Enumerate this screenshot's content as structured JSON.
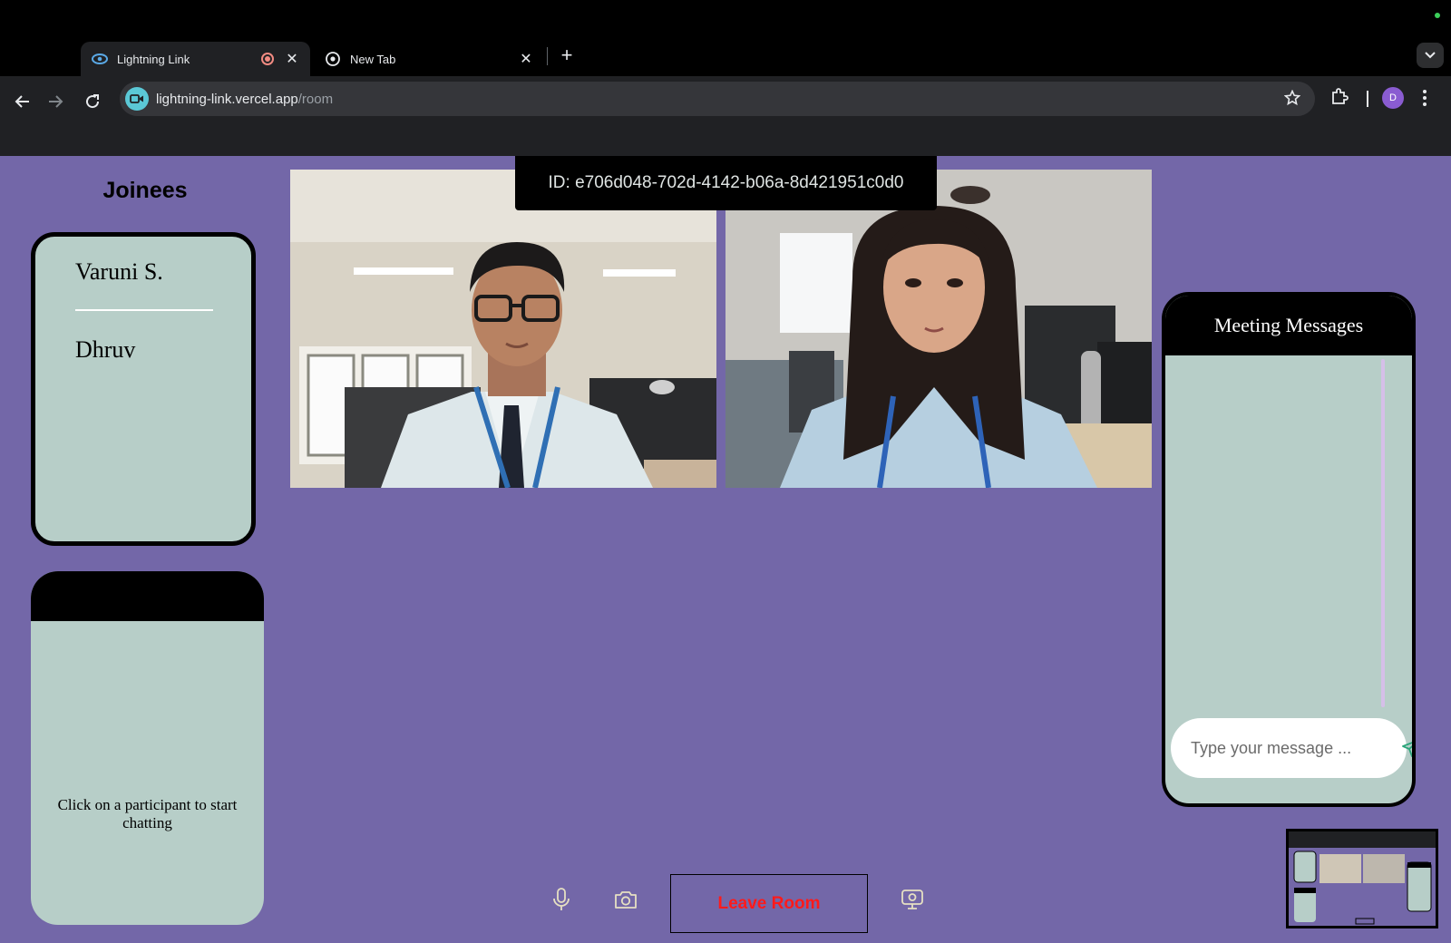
{
  "browser": {
    "tabs": [
      {
        "title": "Lightning Link",
        "active": true
      },
      {
        "title": "New Tab",
        "active": false
      }
    ],
    "url_host": "lightning-link.vercel.app",
    "url_path": "/room",
    "profile_initial": "D"
  },
  "room": {
    "meeting_id": "ID: e706d048-702d-4142-b06a-8d421951c0d0",
    "joinees_title": "Joinees",
    "joinees": [
      "Varuni S.",
      "Dhruv"
    ],
    "chat_hint": "Click on a participant to start chatting",
    "messages_title": "Meeting Messages",
    "message_placeholder": "Type your message ...",
    "leave_label": "Leave Room"
  },
  "colors": {
    "page_bg": "#7367a8",
    "panel_bg": "#b7cec8",
    "leave_text": "#ff1a1a"
  },
  "icons": [
    "mic-icon",
    "camera-icon",
    "screen-share-icon",
    "send-icon"
  ]
}
